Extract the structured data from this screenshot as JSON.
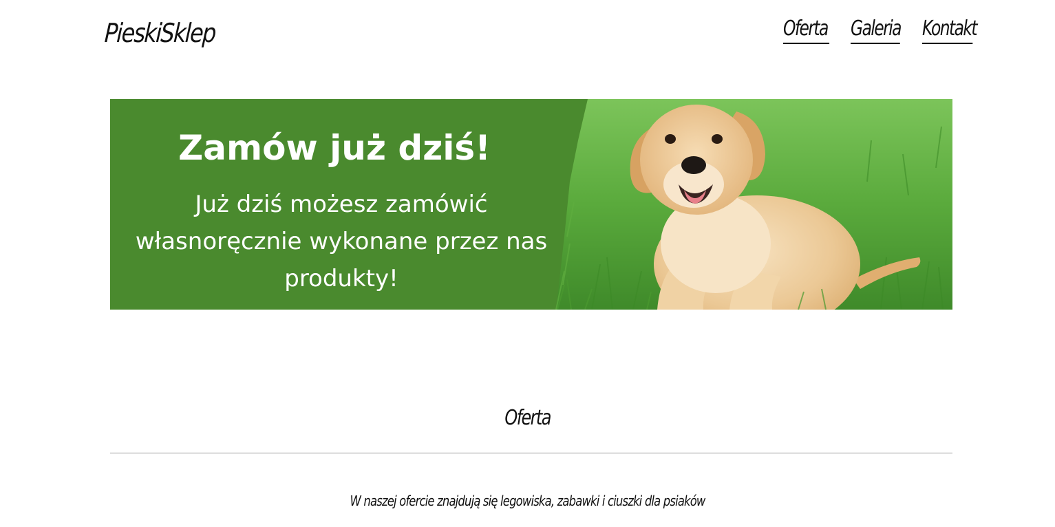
{
  "header": {
    "logo_text": "PieskiSklep",
    "nav": [
      {
        "label": "Oferta"
      },
      {
        "label": "Galeria"
      },
      {
        "label": "Kontakt"
      }
    ]
  },
  "banner": {
    "title": "Zamów już dziś!",
    "body": "Już dziś możesz zamówić własnoręcznie wykonane przez nas produkty!",
    "panel_color": "#4a8a2e",
    "image_subject": "labrador puppy on grass"
  },
  "offer_section": {
    "title": "Oferta",
    "text": "W naszej ofercie znajdują się legowiska, zabawki i ciuszki dla psiaków"
  }
}
